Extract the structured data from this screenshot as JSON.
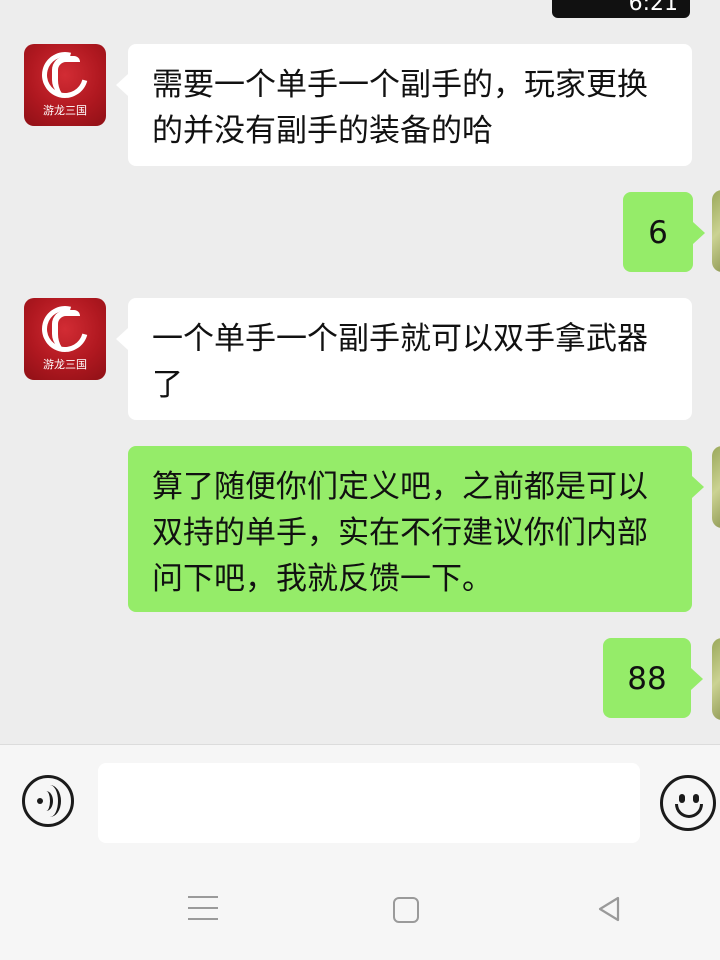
{
  "status": {
    "time": "6:21"
  },
  "messages": [
    {
      "side": "in",
      "avatar": "game-logo-avatar",
      "avatar_brand": "游龙三国",
      "text": "需要一个单手一个副手的，玩家更换的并没有副手的装备的哈"
    },
    {
      "side": "out",
      "avatar": "user-avatar",
      "text": "6"
    },
    {
      "side": "in",
      "avatar": "game-logo-avatar",
      "avatar_brand": "游龙三国",
      "text": "一个单手一个副手就可以双手拿武器了"
    },
    {
      "side": "out",
      "avatar": "user-avatar",
      "text": "算了随便你们定义吧，之前都是可以双持的单手，实在不行建议你们内部问下吧，我就反馈一下。"
    },
    {
      "side": "out",
      "avatar": "user-avatar",
      "text": "88"
    }
  ],
  "input_bar": {
    "voice_icon": "voice-icon",
    "input_value": "",
    "emoji_icon": "emoji-icon"
  },
  "nav_bar": {
    "menu_icon": "menu-icon",
    "home_icon": "home-icon",
    "back_icon": "back-icon"
  },
  "colors": {
    "background": "#ededed",
    "incoming_bubble": "#ffffff",
    "outgoing_bubble": "#95ec69",
    "avatar_red": "#b01820"
  }
}
